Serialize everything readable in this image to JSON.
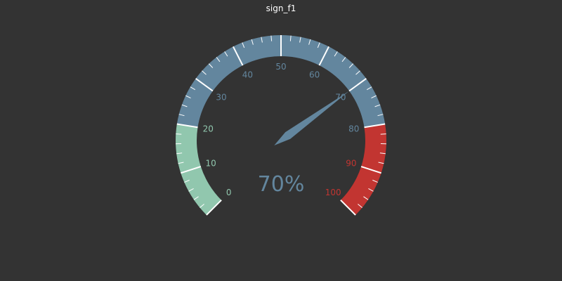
{
  "chart_data": {
    "type": "gauge",
    "title": "sign_f1",
    "value": 70,
    "min": 0,
    "max": 100,
    "split_number": 10,
    "tick_labels": [
      "0",
      "10",
      "20",
      "30",
      "40",
      "50",
      "60",
      "70",
      "80",
      "90",
      "100"
    ],
    "detail": "70%",
    "bands": [
      {
        "to": 0.2,
        "color": "#91c7ae"
      },
      {
        "to": 0.8,
        "color": "#63869e"
      },
      {
        "to": 1.0,
        "color": "#c23531"
      }
    ],
    "colors": {
      "background": "#333333",
      "title": "#ffffff",
      "split_line": "#ffffff",
      "axis_tick": "#ffffff",
      "pointer": "#63869e",
      "detail": "#63869e"
    }
  }
}
